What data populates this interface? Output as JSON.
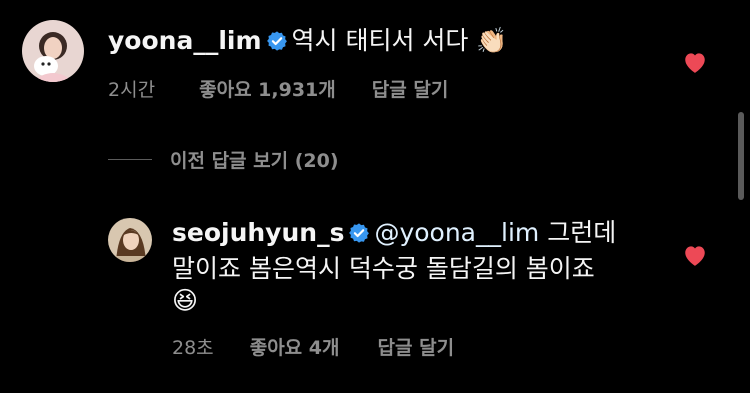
{
  "colors": {
    "background": "#000000",
    "text": "#f5f5f5",
    "muted": "#8e8e8e",
    "verified": "#3897f0",
    "like": "#ed4956"
  },
  "comment1": {
    "username": "yoona__lim",
    "text": "역시 태티서 서다 👏🏻",
    "time": "2시간",
    "likes": "좋아요 1,931개",
    "reply": "답글 달기",
    "liked": true
  },
  "view_previous": "이전 답글 보기 (20)",
  "reply1": {
    "username": "seojuhyun_s",
    "mention": "@yoona__lim",
    "text_line1": "그런데",
    "text_line2": "말이죠 봄은역시 덕수궁 돌담길의 봄이죠",
    "emoji": "😆",
    "time": "28초",
    "likes": "좋아요 4개",
    "reply": "답글 달기",
    "liked": true
  },
  "icons": {
    "verified": "verified-badge-icon",
    "like": "heart-icon"
  }
}
